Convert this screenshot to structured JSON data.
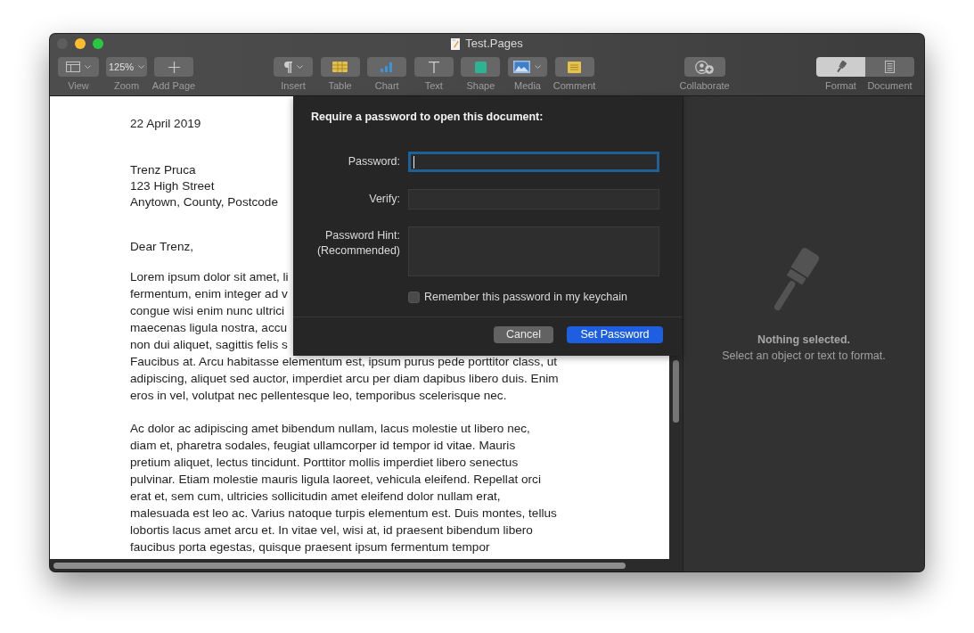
{
  "window": {
    "title": "Test.Pages",
    "controls": [
      {
        "kind": "close",
        "disabled": true
      },
      {
        "kind": "minimize",
        "disabled": false
      },
      {
        "kind": "zoom",
        "disabled": false
      }
    ]
  },
  "toolbar": {
    "groups": [
      {
        "items": [
          {
            "kind": "view",
            "label": "View",
            "menu": true
          },
          {
            "kind": "zoom",
            "label": "Zoom",
            "value": "125%",
            "menu": true
          },
          {
            "kind": "add-page",
            "label": "Add Page",
            "menu": false
          }
        ]
      },
      {
        "items": [
          {
            "kind": "insert",
            "label": "Insert",
            "menu": true
          },
          {
            "kind": "table",
            "label": "Table",
            "menu": false
          },
          {
            "kind": "chart",
            "label": "Chart",
            "menu": false
          },
          {
            "kind": "text",
            "label": "Text",
            "menu": false
          },
          {
            "kind": "shape",
            "label": "Shape",
            "menu": false
          },
          {
            "kind": "media",
            "label": "Media",
            "menu": true
          },
          {
            "kind": "comment",
            "label": "Comment",
            "menu": false
          }
        ]
      },
      {
        "items": [
          {
            "kind": "collaborate",
            "label": "Collaborate",
            "menu": false
          }
        ]
      }
    ],
    "inspector_tabs": [
      {
        "kind": "format",
        "label": "Format",
        "selected": true
      },
      {
        "kind": "document",
        "label": "Document",
        "selected": false
      }
    ]
  },
  "letter": {
    "date": "22 April 2019",
    "address": [
      "Trenz Pruca",
      "123 High Street",
      "Anytown, County, Postcode"
    ],
    "salutation": "Dear Trenz,",
    "paragraphs": [
      {
        "lines": [
          "Lorem ipsum dolor sit amet, li",
          "fermentum, enim integer ad v",
          "congue wisi enim nunc ultrici",
          "maecenas ligula nostra, accu",
          "non dui aliquet, sagittis felis s",
          "Faucibus at. Arcu habitasse elementum est, ipsum purus pede porttitor class, ut",
          "adipiscing, aliquet sed auctor, imperdiet arcu per diam dapibus libero duis. Enim",
          "eros in vel, volutpat nec pellentesque leo, temporibus scelerisque nec."
        ]
      },
      {
        "lines": [
          "Ac dolor ac adipiscing amet bibendum nullam, lacus molestie ut libero nec,",
          "diam et, pharetra sodales, feugiat ullamcorper id tempor id vitae. Mauris",
          "pretium aliquet, lectus tincidunt. Porttitor mollis imperdiet libero senectus",
          "pulvinar. Etiam molestie mauris ligula laoreet, vehicula eleifend. Repellat orci",
          "erat et, sem cum, ultricies sollicitudin amet eleifend dolor nullam erat,",
          "malesuada est leo ac. Varius natoque turpis elementum est. Duis montes, tellus",
          "lobortis lacus amet arcu et. In vitae vel, wisi at, id praesent bibendum libero",
          "faucibus porta egestas, quisque praesent ipsum fermentum tempor"
        ]
      }
    ]
  },
  "dialog": {
    "title": "Require a password to open this document:",
    "fields": [
      {
        "kind": "secure",
        "label": "Password:",
        "focused": true
      },
      {
        "kind": "secure",
        "label": "Verify:",
        "focused": false
      },
      {
        "kind": "multiline",
        "label": "Password Hint:",
        "note": "(Recommended)",
        "focused": false
      }
    ],
    "checkbox": {
      "label": "Remember this password in my keychain",
      "checked": false
    },
    "buttons": [
      {
        "kind": "secondary",
        "label": "Cancel"
      },
      {
        "kind": "primary",
        "label": "Set Password"
      }
    ]
  },
  "inspector": {
    "title": "Nothing selected.",
    "message": "Select an object or text to format."
  }
}
